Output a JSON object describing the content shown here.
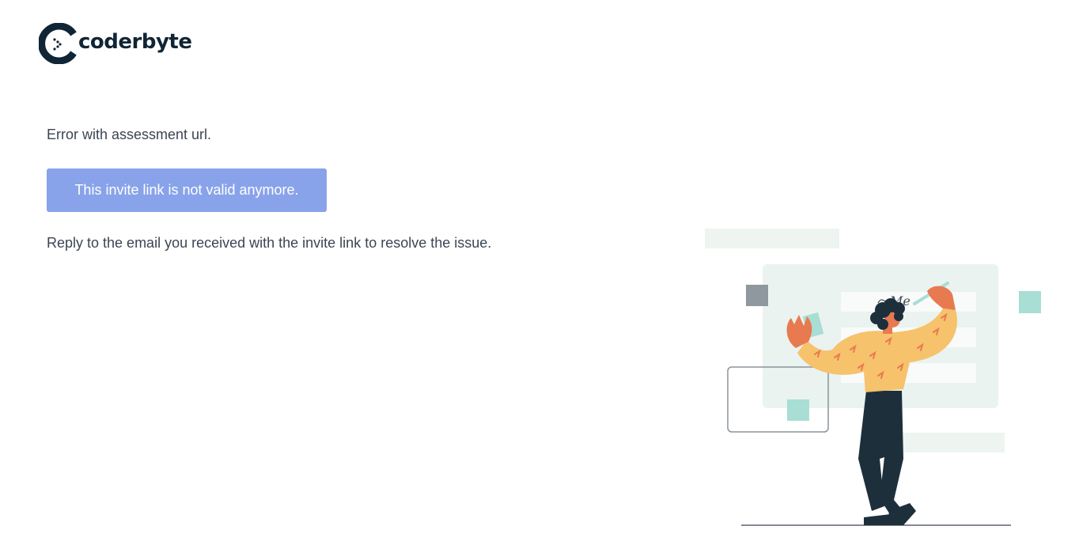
{
  "brand": {
    "name": "coderbyte",
    "logo_icon": "coderbyte-logo-icon",
    "colors": {
      "brand_dark": "#102535",
      "banner_bg": "#88a3ea",
      "text": "#3b4553"
    }
  },
  "message": {
    "title": "Error with assessment url.",
    "banner": "This invite link is not valid anymore.",
    "help": "Reply to the email you received with the invite link to resolve the issue."
  },
  "illustration": {
    "icon": "person-signing-document-illustration",
    "signature_text": "Me"
  }
}
